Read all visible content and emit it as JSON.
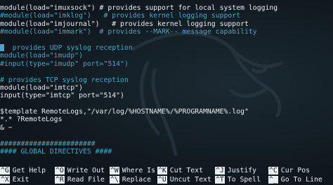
{
  "editor": {
    "lines": [
      {
        "text": "module(load=\"imuxsock\") # provides support for local system logging",
        "kind": "kw"
      },
      {
        "text": "#module(load=\"imklog\")   # provides kernel logging support",
        "kind": "comment"
      },
      {
        "text": "module(load=\"imjournal\")   # provides kernel logging support",
        "kind": "kw"
      },
      {
        "text": "#module(load=\"immark\")  # provides --MARK-- message capability",
        "kind": "comment"
      },
      {
        "text": "",
        "kind": "kw"
      },
      {
        "text": "  provides UDP syslog reception",
        "kind": "comment",
        "cursor": true
      },
      {
        "text": "module(load=\"imudp\")",
        "kind": "comment"
      },
      {
        "text": "#input(type=\"imudp\" port=\"514\")",
        "kind": "comment"
      },
      {
        "text": "",
        "kind": "kw"
      },
      {
        "text": "# provides TCP syslog reception",
        "kind": "comment"
      },
      {
        "text": "module(load=\"imtcp\")",
        "kind": "kw"
      },
      {
        "text": "input(type=\"imtcp\" port=\"514\")",
        "kind": "kw"
      },
      {
        "text": "",
        "kind": "kw"
      },
      {
        "text": "$template RemoteLogs,\"/var/log/%HOSTNAME%/%PROGRAMNAME%.log\"",
        "kind": "kw"
      },
      {
        "text": "*.* ?RemoteLogs",
        "kind": "kw"
      },
      {
        "text": "& ~",
        "kind": "kw"
      },
      {
        "text": "",
        "kind": "kw"
      },
      {
        "text": "#######################",
        "kind": "comment"
      },
      {
        "text": "#### GLOBAL DIRECTIVES ####",
        "kind": "comment"
      }
    ]
  },
  "shortcuts": {
    "row1": [
      {
        "key": "^G",
        "label": "Get Help"
      },
      {
        "key": "^O",
        "label": "Write Out"
      },
      {
        "key": "^W",
        "label": "Where Is"
      },
      {
        "key": "^K",
        "label": "Cut Text"
      },
      {
        "key": "^J",
        "label": "Justify"
      },
      {
        "key": "^C",
        "label": "Cur Pos"
      }
    ],
    "row2": [
      {
        "key": "^X",
        "label": "Exit"
      },
      {
        "key": "^R",
        "label": "Read File"
      },
      {
        "key": "^\\",
        "label": "Replace"
      },
      {
        "key": "^U",
        "label": "Uncut Text"
      },
      {
        "key": "^T",
        "label": "To Spell"
      },
      {
        "key": "^_",
        "label": "Go To Line"
      }
    ]
  },
  "colors": {
    "background": "#121b22",
    "text": "#e8eef1",
    "comment": "#4aa3c8"
  },
  "icons": {
    "watermark": "kali-dragon-icon"
  }
}
